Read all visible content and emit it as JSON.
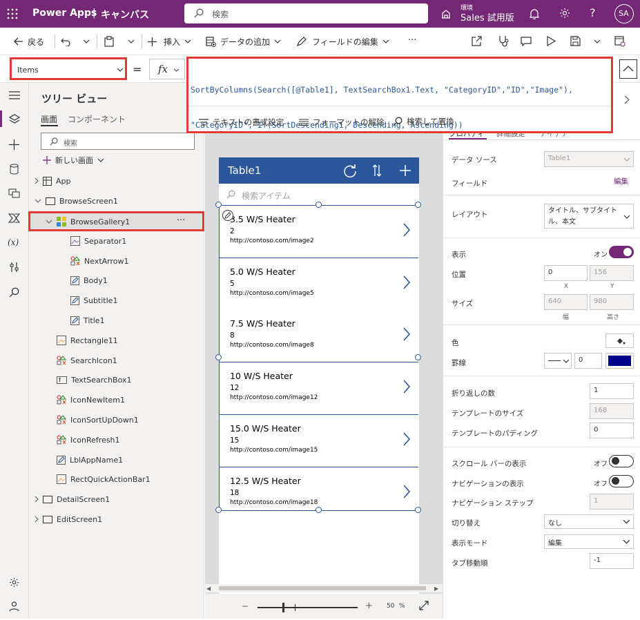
{
  "topbar": {
    "app_title": "Power Apps",
    "separator": "|",
    "app_type": "キャンバス",
    "search_placeholder": "検索",
    "env_label": "環境",
    "env_name": "Sales 試用版",
    "avatar_initials": "SA"
  },
  "commandbar": {
    "back": "戻る",
    "insert": "挿入",
    "add_data": "データの追加",
    "edit_fields": "フィールドの編集",
    "more": "···"
  },
  "formula": {
    "property": "Items",
    "equals": "=",
    "fx": "fx",
    "line1": "SortByColumns(Search([@Table1], TextSearchBox1.Text, \"CategoryID\",\"ID\",\"Image\"),",
    "line2": "\"CategoryID\", If(SortDescending1, Descending, Ascending))",
    "format_text": "テキストの書式設定",
    "remove_format": "フォーマットの解除",
    "find_replace": "検索して置換"
  },
  "tree": {
    "title": "ツリー ビュー",
    "tab_screens": "画面",
    "tab_components": "コンポーネント",
    "search_placeholder": "検索",
    "new_screen": "新しい画面",
    "nodes": [
      {
        "label": "App"
      },
      {
        "label": "BrowseScreen1"
      },
      {
        "label": "BrowseGallery1"
      },
      {
        "label": "Separator1"
      },
      {
        "label": "NextArrow1"
      },
      {
        "label": "Body1"
      },
      {
        "label": "Subtitle1"
      },
      {
        "label": "Title1"
      },
      {
        "label": "Rectangle11"
      },
      {
        "label": "SearchIcon1"
      },
      {
        "label": "TextSearchBox1"
      },
      {
        "label": "IconNewItem1"
      },
      {
        "label": "IconSortUpDown1"
      },
      {
        "label": "IconRefresh1"
      },
      {
        "label": "LblAppName1"
      },
      {
        "label": "RectQuickActionBar1"
      },
      {
        "label": "DetailScreen1"
      },
      {
        "label": "EditScreen1"
      }
    ],
    "more_label": "···"
  },
  "canvas": {
    "app_header": "Table1",
    "search_placeholder": "検索アイテム",
    "items": [
      {
        "title": "3.5 W/S Heater",
        "subtitle": "2",
        "body": "http://contoso.com/image2"
      },
      {
        "title": "5.0 W/S Heater",
        "subtitle": "5",
        "body": "http://contoso.com/image5"
      },
      {
        "title": "7.5 W/S Heater",
        "subtitle": "8",
        "body": "http://contoso.com/image8"
      },
      {
        "title": "10 W/S Heater",
        "subtitle": "12",
        "body": "http://contoso.com/image12"
      },
      {
        "title": "15.0 W/S Heater",
        "subtitle": "15",
        "body": "http://contoso.com/image15"
      },
      {
        "title": "12.5 W/S Heater",
        "subtitle": "18",
        "body": "http://contoso.com/image18"
      }
    ],
    "zoom_value": "50",
    "zoom_unit": "%",
    "zoom_minus": "−",
    "zoom_plus": "+"
  },
  "props": {
    "tab_properties": "プロパティ",
    "tab_advanced": "詳細設定",
    "tab_ideas": "アイデア",
    "datasource_label": "データ ソース",
    "datasource_value": "Table1",
    "fields_label": "フィールド",
    "fields_edit": "編集",
    "layout_label": "レイアウト",
    "layout_value": "タイトル、サブタイトル、本文",
    "visible_label": "表示",
    "visible_state": "オン",
    "position_label": "位置",
    "pos_x": "0",
    "pos_y": "156",
    "x_label": "X",
    "y_label": "Y",
    "size_label": "サイズ",
    "width": "640",
    "height": "980",
    "width_label": "幅",
    "height_label": "高さ",
    "color_label": "色",
    "border_label": "罫線",
    "border_width": "0",
    "border_color": "#00008b",
    "wrap_label": "折り返しの数",
    "wrap_value": "1",
    "template_size_label": "テンプレートのサイズ",
    "template_size_value": "168",
    "template_padding_label": "テンプレートのパディング",
    "template_padding_value": "0",
    "scrollbar_label": "スクロール バーの表示",
    "scrollbar_state": "オフ",
    "navigation_label": "ナビゲーションの表示",
    "navigation_state": "オフ",
    "nav_step_label": "ナビゲーション ステップ",
    "nav_step_value": "1",
    "transition_label": "切り替え",
    "transition_value": "なし",
    "display_mode_label": "表示モード",
    "display_mode_value": "編集",
    "tab_index_label": "タブ移動順",
    "tab_index_value": "-1"
  },
  "colors": {
    "brand": "#742774",
    "gallery_header": "#2b579a",
    "highlight": "#e53935"
  }
}
